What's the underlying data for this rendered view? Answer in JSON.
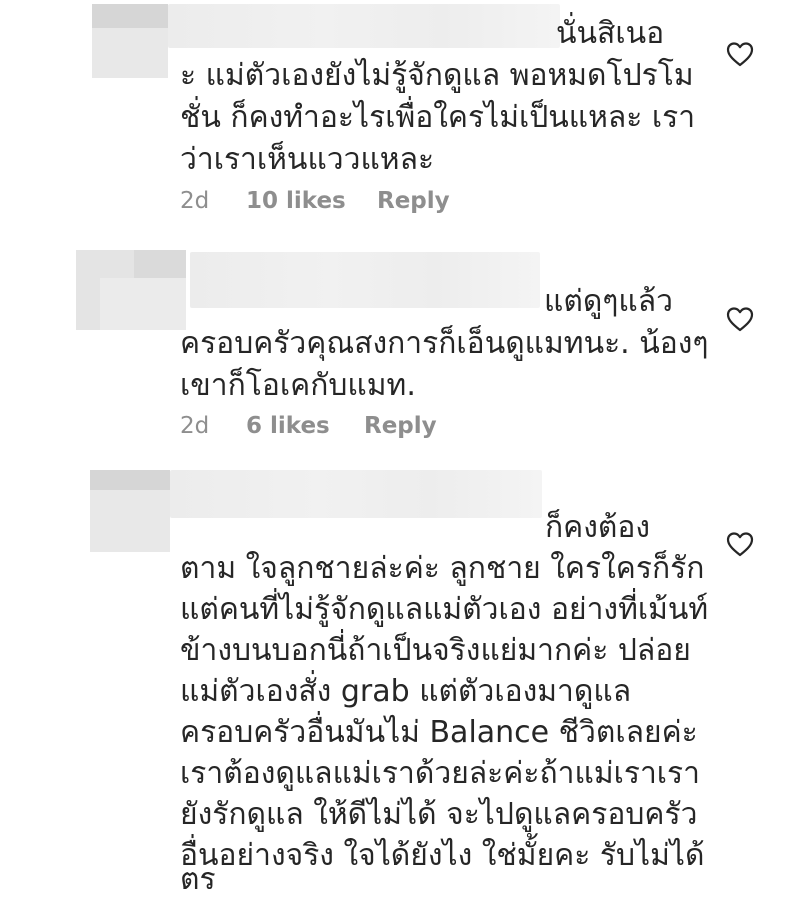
{
  "comments": [
    {
      "lines": [
        "นั่นสิเนอ",
        "ะ แม่ตัวเองยังไม่รู้จักดูแล พอหมดโปรโม",
        "ชั่น ก็คงทำอะไรเพื่อใครไม่เป็นแหละ เรา",
        "ว่าเราเห็นแววแหละ"
      ],
      "time": "2d",
      "likes": "10 likes",
      "reply": "Reply"
    },
    {
      "lines": [
        "แต่ดูๆแล้ว",
        "ครอบครัวคุณสงการก็เอ็นดูแมทนะ. น้องๆ",
        "เขาก็โอเคกับแมท."
      ],
      "time": "2d",
      "likes": "6 likes",
      "reply": "Reply"
    },
    {
      "lines": [
        "ก็คงต้อง",
        "ตาม ใจลูกชายล่ะค่ะ ลูกชาย ใครใครก็รัก",
        "แต่คนที่ไม่รู้จักดูแลแม่ตัวเอง อย่างที่เม้นท์",
        "ข้างบนบอกนี่ถ้าเป็นจริงแย่มากค่ะ ปล่อย",
        "แม่ตัวเองสั่ง grab แต่ตัวเองมาดูแล",
        "ครอบครัวอื่นมันไม่ Balance ชีวิตเลยค่ะ",
        "เราต้องดูแลแม่เราด้วยล่ะค่ะถ้าแม่เราเรา",
        "ยังรักดูแล ให้ดีไม่ได้ จะไปดูแลครอบครัว",
        "อื่นอย่างจริง ใจได้ยังไง ใช่มั้ยคะ รับไม่ได้",
        "ตร"
      ]
    }
  ],
  "icons": {
    "like": "heart-outline-icon"
  },
  "colors": {
    "text": "#262626",
    "meta": "#8e8e8e",
    "background": "#ffffff"
  }
}
